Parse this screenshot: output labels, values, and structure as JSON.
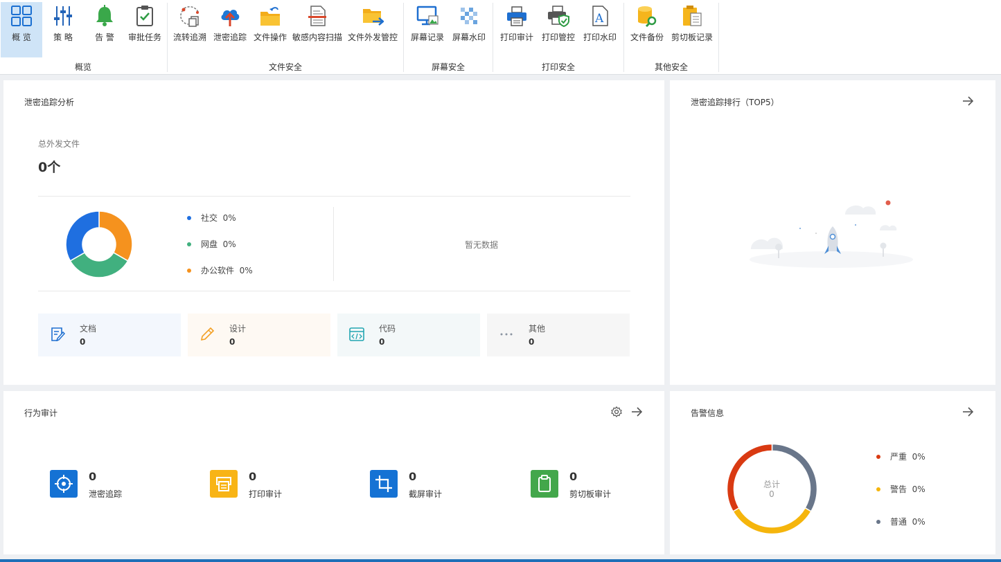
{
  "ribbon": {
    "buttons": [
      {
        "label": "概 览",
        "icon": "dashboard-grid-icon"
      },
      {
        "label": "策 略",
        "icon": "sliders-icon"
      },
      {
        "label": "告 警",
        "icon": "bell-icon"
      },
      {
        "label": "审批任务",
        "icon": "clipboard-check-icon"
      },
      {
        "label": "流转追溯",
        "icon": "flow-trace-icon"
      },
      {
        "label": "泄密追踪",
        "icon": "cloud-upload-icon"
      },
      {
        "label": "文件操作",
        "icon": "folder-arrow-icon"
      },
      {
        "label": "敏感内容扫描",
        "icon": "document-scan-icon"
      },
      {
        "label": "文件外发管控",
        "icon": "folder-send-icon"
      },
      {
        "label": "屏幕记录",
        "icon": "monitor-image-icon"
      },
      {
        "label": "屏幕水印",
        "icon": "checker-watermark-icon"
      },
      {
        "label": "打印审计",
        "icon": "printer-icon"
      },
      {
        "label": "打印管控",
        "icon": "printer-shield-icon"
      },
      {
        "label": "打印水印",
        "icon": "document-letter-a-icon"
      },
      {
        "label": "文件备份",
        "icon": "database-search-icon"
      },
      {
        "label": "剪切板记录",
        "icon": "clipboard-docs-icon"
      }
    ],
    "groups": [
      "概览",
      "文件安全",
      "屏幕安全",
      "打印安全",
      "其他安全"
    ]
  },
  "leak_analysis": {
    "title": "泄密追踪分析",
    "total_label": "总外发文件",
    "total_value": "0个",
    "legend": [
      {
        "label": "社交",
        "value": "0%",
        "color": "#1f6fe0"
      },
      {
        "label": "网盘",
        "value": "0%",
        "color": "#41b07f"
      },
      {
        "label": "办公软件",
        "value": "0%",
        "color": "#f5921e"
      }
    ],
    "donut_shares": [
      0.333,
      0.334,
      0.333
    ],
    "no_data": "暂无数据",
    "tiles": [
      {
        "name": "文档",
        "value": "0",
        "icon": "document-edit-icon",
        "bg": "#f3f7fd"
      },
      {
        "name": "设计",
        "value": "0",
        "icon": "pencil-icon",
        "bg": "#fef9f3"
      },
      {
        "name": "代码",
        "value": "0",
        "icon": "code-window-icon",
        "bg": "#f3f8f9"
      },
      {
        "name": "其他",
        "value": "0",
        "icon": "more-dots-icon",
        "bg": "#f6f6f6"
      }
    ]
  },
  "ranking": {
    "title": "泄密追踪排行（TOP5）"
  },
  "behavior_audit": {
    "title": "行为审计",
    "items": [
      {
        "name": "泄密追踪",
        "value": "0",
        "icon": "target-icon",
        "color": "#1572d4"
      },
      {
        "name": "打印审计",
        "value": "0",
        "icon": "printer-icon",
        "color": "#f8b416"
      },
      {
        "name": "截屏审计",
        "value": "0",
        "icon": "crop-icon",
        "color": "#1572d4"
      },
      {
        "name": "剪切板审计",
        "value": "0",
        "icon": "clipboard-icon",
        "color": "#43a74b"
      }
    ]
  },
  "alerts": {
    "title": "告警信息",
    "center_label": "总计",
    "center_value": "0",
    "legend": [
      {
        "label": "严重",
        "value": "0%",
        "color": "#d93a12"
      },
      {
        "label": "警告",
        "value": "0%",
        "color": "#f5b50c"
      },
      {
        "label": "普通",
        "value": "0%",
        "color": "#69768a"
      }
    ],
    "donut_shares": [
      0.333,
      0.334,
      0.333
    ]
  }
}
